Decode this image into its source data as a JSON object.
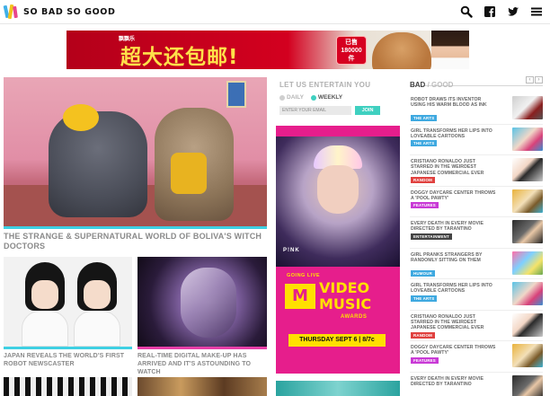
{
  "header": {
    "logo_text": "SO BAD SO GOOD",
    "icons": [
      "search-icon",
      "facebook-icon",
      "twitter-icon",
      "menu-icon"
    ]
  },
  "banner_ad": {
    "small_text": "飘飘乐",
    "headline": "超大还包邮!",
    "badge_line1": "已售",
    "badge_line2": "180000",
    "badge_line3": "件"
  },
  "hero": {
    "title": "THE STRANGE & SUPERNATURAL WORLD OF BOLIVA'S WITCH DOCTORS"
  },
  "cards": [
    {
      "title": "JAPAN REVEALS THE WORLD'S FIRST ROBOT NEWSCASTER"
    },
    {
      "title": "REAL-TIME DIGITAL MAKE-UP HAS ARRIVED AND IT'S ASTOUNDING TO WATCH"
    }
  ],
  "newsletter": {
    "title": "LET US ENTERTAIN YOU",
    "option_daily": "DAILY",
    "option_weekly": "WEEKLY",
    "email_placeholder": "ENTER YOUR EMAIL",
    "join_label": "JOIN"
  },
  "mtv_ad": {
    "artist": "P!NK",
    "going_live": "GOING LIVE",
    "logo": "M",
    "line1": "VIDEO",
    "line2": "MUSIC",
    "awards": "AWARDS",
    "date": "THURSDAY SEPT 6 | 8/7c"
  },
  "sidebar": {
    "bad": "BAD",
    "separator": " / ",
    "good": "GOOD",
    "prev": "‹",
    "next": "›",
    "items": [
      {
        "title": "ROBOT DRAWS ITS INVENTOR USING HIS WARM BLOOD AS INK",
        "tag": "THE ARTS",
        "tag_color": "#3fa9e0"
      },
      {
        "title": "GIRL TRANSFORMS HER LIPS INTO LOVEABLE CARTOONS",
        "tag": "THE ARTS",
        "tag_color": "#3fa9e0"
      },
      {
        "title": "CRISTIANO RONALDO JUST STARRED IN THE WEIRDEST JAPANESE COMMERCIAL EVER",
        "tag": "RANDOM",
        "tag_color": "#e0413f"
      },
      {
        "title": "DOGGY DAYCARE CENTER THROWS A 'POOL PAWTY'",
        "tag": "FEATURES",
        "tag_color": "#c93ad6"
      },
      {
        "title": "EVERY DEATH IN EVERY MOVIE DIRECTED BY TARANTINO",
        "tag": "ENTERTAINMENT",
        "tag_color": "#444444"
      },
      {
        "title": "GIRL PRANKS STRANGERS BY RANDOMLY SITTING ON THEM",
        "tag": "HUMOUR",
        "tag_color": "#3fa9e0"
      },
      {
        "title": "GIRL TRANSFORMS HER LIPS INTO LOVEABLE CARTOONS",
        "tag": "THE ARTS",
        "tag_color": "#3fa9e0"
      },
      {
        "title": "CRISTIANO RONALDO JUST STARRED IN THE WEIRDEST JAPANESE COMMERCIAL EVER",
        "tag": "RANDOM",
        "tag_color": "#e0413f"
      },
      {
        "title": "DOGGY DAYCARE CENTER THROWS A 'POOL PAWTY'",
        "tag": "FEATURES",
        "tag_color": "#c93ad6"
      },
      {
        "title": "EVERY DEATH IN EVERY MOVIE DIRECTED BY TARANTINO",
        "tag": "",
        "tag_color": "#444444"
      }
    ]
  }
}
